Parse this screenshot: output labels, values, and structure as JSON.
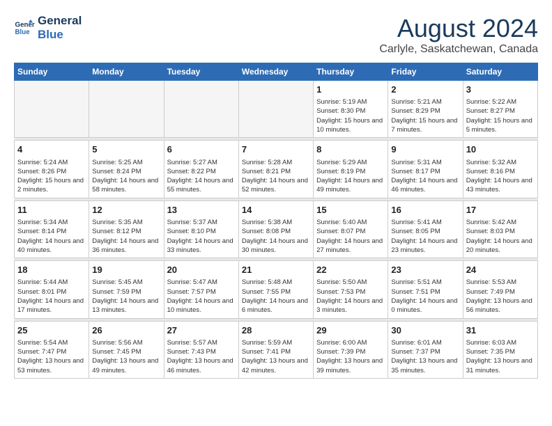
{
  "header": {
    "logo_line1": "General",
    "logo_line2": "Blue",
    "month_title": "August 2024",
    "location": "Carlyle, Saskatchewan, Canada"
  },
  "weekdays": [
    "Sunday",
    "Monday",
    "Tuesday",
    "Wednesday",
    "Thursday",
    "Friday",
    "Saturday"
  ],
  "weeks": [
    [
      {
        "day": "",
        "info": ""
      },
      {
        "day": "",
        "info": ""
      },
      {
        "day": "",
        "info": ""
      },
      {
        "day": "",
        "info": ""
      },
      {
        "day": "1",
        "info": "Sunrise: 5:19 AM\nSunset: 8:30 PM\nDaylight: 15 hours\nand 10 minutes."
      },
      {
        "day": "2",
        "info": "Sunrise: 5:21 AM\nSunset: 8:29 PM\nDaylight: 15 hours\nand 7 minutes."
      },
      {
        "day": "3",
        "info": "Sunrise: 5:22 AM\nSunset: 8:27 PM\nDaylight: 15 hours\nand 5 minutes."
      }
    ],
    [
      {
        "day": "4",
        "info": "Sunrise: 5:24 AM\nSunset: 8:26 PM\nDaylight: 15 hours\nand 2 minutes."
      },
      {
        "day": "5",
        "info": "Sunrise: 5:25 AM\nSunset: 8:24 PM\nDaylight: 14 hours\nand 58 minutes."
      },
      {
        "day": "6",
        "info": "Sunrise: 5:27 AM\nSunset: 8:22 PM\nDaylight: 14 hours\nand 55 minutes."
      },
      {
        "day": "7",
        "info": "Sunrise: 5:28 AM\nSunset: 8:21 PM\nDaylight: 14 hours\nand 52 minutes."
      },
      {
        "day": "8",
        "info": "Sunrise: 5:29 AM\nSunset: 8:19 PM\nDaylight: 14 hours\nand 49 minutes."
      },
      {
        "day": "9",
        "info": "Sunrise: 5:31 AM\nSunset: 8:17 PM\nDaylight: 14 hours\nand 46 minutes."
      },
      {
        "day": "10",
        "info": "Sunrise: 5:32 AM\nSunset: 8:16 PM\nDaylight: 14 hours\nand 43 minutes."
      }
    ],
    [
      {
        "day": "11",
        "info": "Sunrise: 5:34 AM\nSunset: 8:14 PM\nDaylight: 14 hours\nand 40 minutes."
      },
      {
        "day": "12",
        "info": "Sunrise: 5:35 AM\nSunset: 8:12 PM\nDaylight: 14 hours\nand 36 minutes."
      },
      {
        "day": "13",
        "info": "Sunrise: 5:37 AM\nSunset: 8:10 PM\nDaylight: 14 hours\nand 33 minutes."
      },
      {
        "day": "14",
        "info": "Sunrise: 5:38 AM\nSunset: 8:08 PM\nDaylight: 14 hours\nand 30 minutes."
      },
      {
        "day": "15",
        "info": "Sunrise: 5:40 AM\nSunset: 8:07 PM\nDaylight: 14 hours\nand 27 minutes."
      },
      {
        "day": "16",
        "info": "Sunrise: 5:41 AM\nSunset: 8:05 PM\nDaylight: 14 hours\nand 23 minutes."
      },
      {
        "day": "17",
        "info": "Sunrise: 5:42 AM\nSunset: 8:03 PM\nDaylight: 14 hours\nand 20 minutes."
      }
    ],
    [
      {
        "day": "18",
        "info": "Sunrise: 5:44 AM\nSunset: 8:01 PM\nDaylight: 14 hours\nand 17 minutes."
      },
      {
        "day": "19",
        "info": "Sunrise: 5:45 AM\nSunset: 7:59 PM\nDaylight: 14 hours\nand 13 minutes."
      },
      {
        "day": "20",
        "info": "Sunrise: 5:47 AM\nSunset: 7:57 PM\nDaylight: 14 hours\nand 10 minutes."
      },
      {
        "day": "21",
        "info": "Sunrise: 5:48 AM\nSunset: 7:55 PM\nDaylight: 14 hours\nand 6 minutes."
      },
      {
        "day": "22",
        "info": "Sunrise: 5:50 AM\nSunset: 7:53 PM\nDaylight: 14 hours\nand 3 minutes."
      },
      {
        "day": "23",
        "info": "Sunrise: 5:51 AM\nSunset: 7:51 PM\nDaylight: 14 hours\nand 0 minutes."
      },
      {
        "day": "24",
        "info": "Sunrise: 5:53 AM\nSunset: 7:49 PM\nDaylight: 13 hours\nand 56 minutes."
      }
    ],
    [
      {
        "day": "25",
        "info": "Sunrise: 5:54 AM\nSunset: 7:47 PM\nDaylight: 13 hours\nand 53 minutes."
      },
      {
        "day": "26",
        "info": "Sunrise: 5:56 AM\nSunset: 7:45 PM\nDaylight: 13 hours\nand 49 minutes."
      },
      {
        "day": "27",
        "info": "Sunrise: 5:57 AM\nSunset: 7:43 PM\nDaylight: 13 hours\nand 46 minutes."
      },
      {
        "day": "28",
        "info": "Sunrise: 5:59 AM\nSunset: 7:41 PM\nDaylight: 13 hours\nand 42 minutes."
      },
      {
        "day": "29",
        "info": "Sunrise: 6:00 AM\nSunset: 7:39 PM\nDaylight: 13 hours\nand 39 minutes."
      },
      {
        "day": "30",
        "info": "Sunrise: 6:01 AM\nSunset: 7:37 PM\nDaylight: 13 hours\nand 35 minutes."
      },
      {
        "day": "31",
        "info": "Sunrise: 6:03 AM\nSunset: 7:35 PM\nDaylight: 13 hours\nand 31 minutes."
      }
    ]
  ]
}
